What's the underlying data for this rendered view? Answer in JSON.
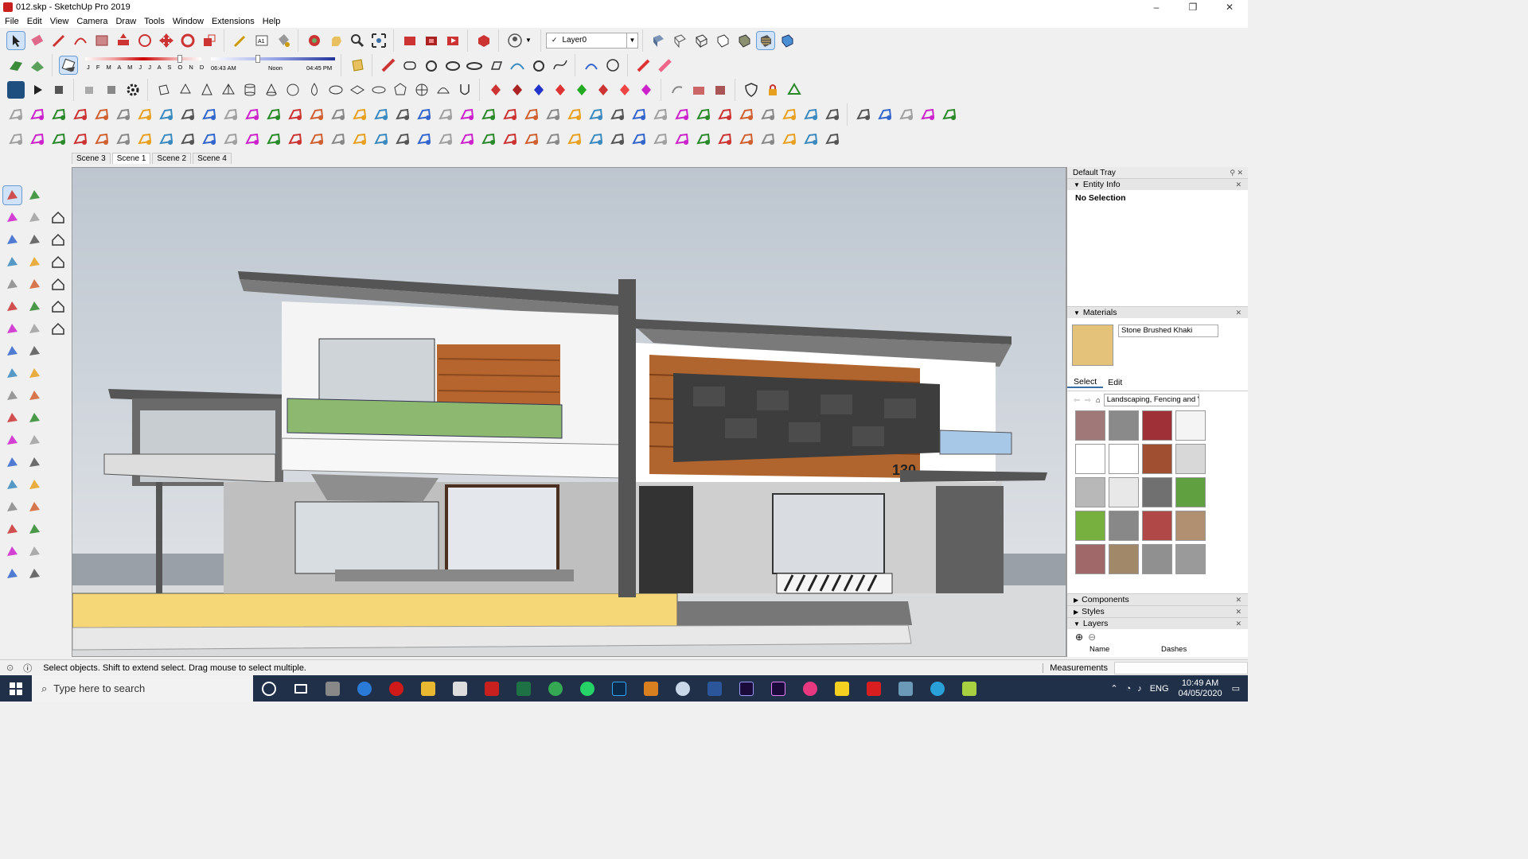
{
  "window": {
    "title": "012.skp - SketchUp Pro 2019",
    "controls": [
      "–",
      "❐",
      "✕"
    ]
  },
  "menu": [
    "File",
    "Edit",
    "View",
    "Camera",
    "Draw",
    "Tools",
    "Window",
    "Extensions",
    "Help"
  ],
  "layer_select": {
    "value": "Layer0"
  },
  "shadows": {
    "months": "J F M A M J J A S O N D",
    "time_start": "06:43 AM",
    "time_mid": "Noon",
    "time_end": "04:45 PM"
  },
  "scenes": [
    "Scene 3",
    "Scene 1",
    "Scene 2",
    "Scene 4"
  ],
  "active_scene": "Scene 1",
  "model": {
    "house_number": "130"
  },
  "tray": {
    "title": "Default Tray",
    "entity_info": {
      "label": "Entity Info",
      "value": "No Selection"
    },
    "materials": {
      "label": "Materials",
      "name": "Stone Brushed Khaki",
      "tab_select": "Select",
      "tab_edit": "Edit",
      "collection": "Landscaping, Fencing and V"
    },
    "components": "Components",
    "styles": "Styles",
    "layers": {
      "label": "Layers",
      "col_name": "Name",
      "col_dashes": "Dashes"
    }
  },
  "status": {
    "message": "Select objects. Shift to extend select. Drag mouse to select multiple.",
    "measurements": "Measurements"
  },
  "taskbar": {
    "search_placeholder": "Type here to search",
    "lang": "ENG",
    "time": "10:49 AM",
    "date": "04/05/2020"
  }
}
